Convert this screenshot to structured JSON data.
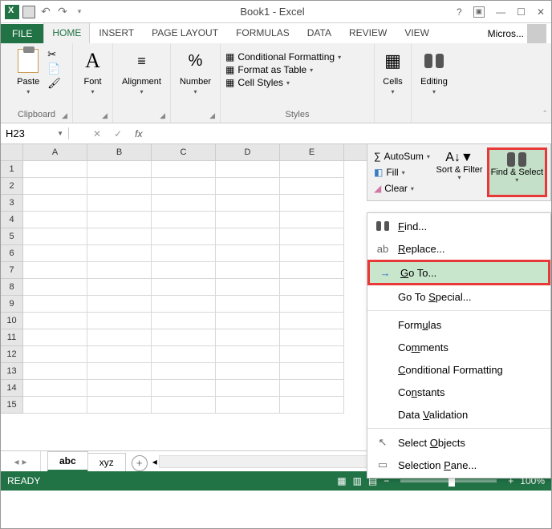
{
  "title": "Book1 - Excel",
  "ribbon_tabs": {
    "file": "FILE",
    "home": "HOME",
    "insert": "INSERT",
    "page_layout": "PAGE LAYOUT",
    "formulas": "FORMULAS",
    "data": "DATA",
    "review": "REVIEW",
    "view": "VIEW",
    "account": "Micros..."
  },
  "ribbon": {
    "clipboard": {
      "paste": "Paste",
      "label": "Clipboard"
    },
    "font": {
      "btn": "Font",
      "label": "Font"
    },
    "alignment": {
      "btn": "Alignment",
      "label": ""
    },
    "number": {
      "btn": "Number",
      "label": ""
    },
    "styles": {
      "cond": "Conditional Formatting",
      "table": "Format as Table",
      "cell": "Cell Styles",
      "label": "Styles"
    },
    "cells": {
      "btn": "Cells"
    },
    "editing": {
      "btn": "Editing"
    }
  },
  "namebox": "H23",
  "formula_bar": {
    "fx": "fx"
  },
  "columns": [
    "A",
    "B",
    "C",
    "D",
    "E"
  ],
  "rows": [
    "1",
    "2",
    "3",
    "4",
    "5",
    "6",
    "7",
    "8",
    "9",
    "10",
    "11",
    "12",
    "13",
    "14",
    "15"
  ],
  "sheet_tabs": {
    "active": "abc",
    "other": "xyz"
  },
  "status": {
    "ready": "READY",
    "zoom": "100%"
  },
  "editing_panel": {
    "autosum": "AutoSum",
    "fill": "Fill",
    "clear": "Clear",
    "sort_filter": "Sort & Filter",
    "find_select": "Find & Select"
  },
  "menu": {
    "find": "Find...",
    "replace": "Replace...",
    "goto": "Go To...",
    "gotospecial": "Go To Special...",
    "formulas": "Formulas",
    "comments": "Comments",
    "condfmt": "Conditional Formatting",
    "constants": "Constants",
    "datavalid": "Data Validation",
    "selobjects": "Select Objects",
    "selpane": "Selection Pane..."
  }
}
